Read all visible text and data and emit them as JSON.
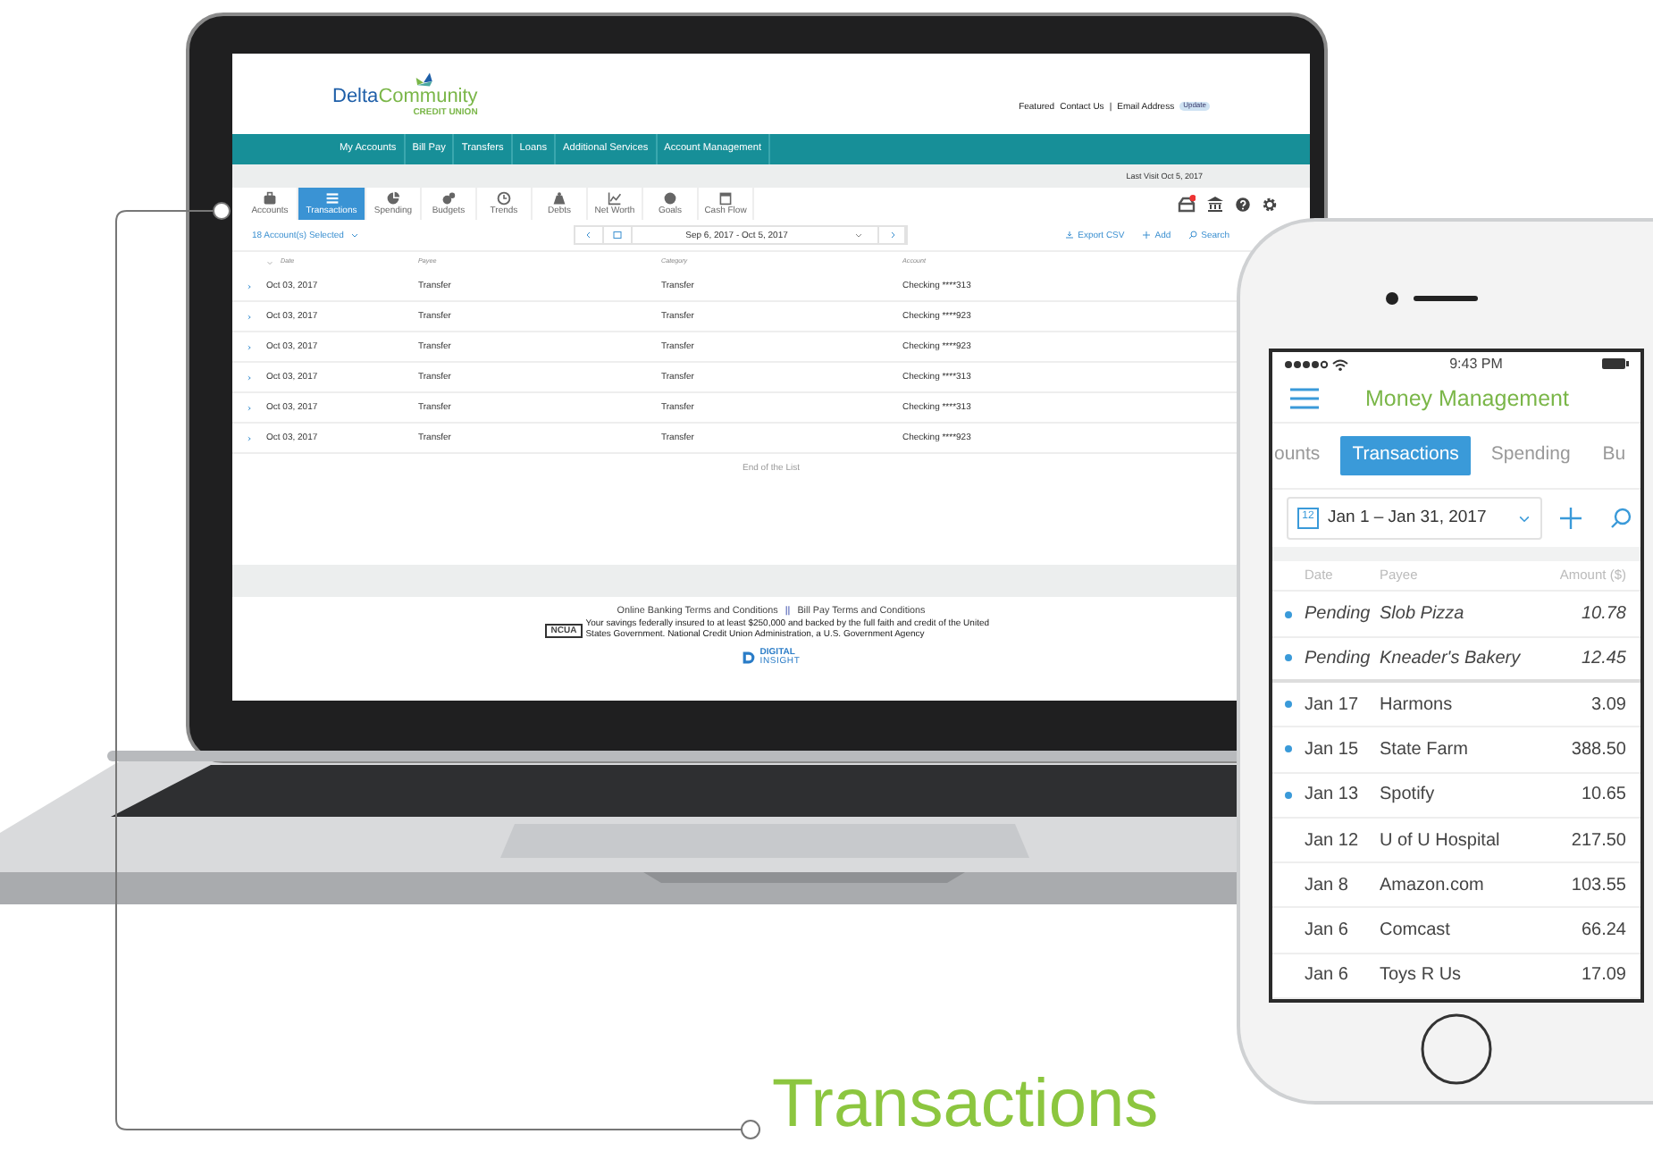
{
  "laptop": {
    "logo": {
      "words": [
        "Delta",
        "Community"
      ],
      "tagline": "CREDIT UNION"
    },
    "top_links": [
      "Featured",
      "Contact Us"
    ],
    "separator": "|",
    "email_label": "Email Address",
    "update_button": "Update",
    "nav": [
      "My Accounts",
      "Bill Pay",
      "Transfers",
      "Loans",
      "Additional Services",
      "Account Management"
    ],
    "last_visit": "Last Visit Oct 5, 2017",
    "tools": [
      {
        "label": "Accounts",
        "selected": false
      },
      {
        "label": "Transactions",
        "selected": true
      },
      {
        "label": "Spending",
        "selected": false
      },
      {
        "label": "Budgets",
        "selected": false
      },
      {
        "label": "Trends",
        "selected": false
      },
      {
        "label": "Debts",
        "selected": false
      },
      {
        "label": "Net Worth",
        "selected": false
      },
      {
        "label": "Goals",
        "selected": false
      },
      {
        "label": "Cash Flow",
        "selected": false
      }
    ],
    "accounts_filter": "18 Account(s) Selected",
    "date_range": "Sep 6, 2017 - Oct 5, 2017",
    "actions": [
      "Export CSV",
      "Add",
      "Search"
    ],
    "columns": [
      "Date",
      "Payee",
      "Category",
      "Account"
    ],
    "rows": [
      {
        "date": "Oct 03, 2017",
        "payee": "Transfer",
        "category": "Transfer",
        "account": "Checking ****313"
      },
      {
        "date": "Oct 03, 2017",
        "payee": "Transfer",
        "category": "Transfer",
        "account": "Checking ****923"
      },
      {
        "date": "Oct 03, 2017",
        "payee": "Transfer",
        "category": "Transfer",
        "account": "Checking ****923"
      },
      {
        "date": "Oct 03, 2017",
        "payee": "Transfer",
        "category": "Transfer",
        "account": "Checking ****313"
      },
      {
        "date": "Oct 03, 2017",
        "payee": "Transfer",
        "category": "Transfer",
        "account": "Checking ****313"
      },
      {
        "date": "Oct 03, 2017",
        "payee": "Transfer",
        "category": "Transfer",
        "account": "Checking ****923"
      }
    ],
    "end_note": "End of the List",
    "footer": {
      "links": [
        "Online Banking Terms and Conditions",
        "Bill Pay Terms and Conditions"
      ],
      "link_separator": "||",
      "insurer": "NCUA",
      "notice": "Your savings federally insured to at least $250,000 and backed by the full faith and credit of the United States Government. National Credit Union Administration, a U.S. Government Agency",
      "brand": [
        "DIGITAL",
        "INSIGHT"
      ]
    }
  },
  "phone": {
    "time": "9:43 PM",
    "title": "Money Management",
    "tabs": [
      {
        "label": "ounts",
        "selected": false
      },
      {
        "label": "Transactions",
        "selected": true
      },
      {
        "label": "Spending",
        "selected": false
      },
      {
        "label": "Bu",
        "selected": false
      }
    ],
    "calendar_day": "12",
    "date_range": "Jan 1 – Jan 31, 2017",
    "columns": [
      "Date",
      "Payee",
      "Amount ($)"
    ],
    "transactions": [
      {
        "date": "Pending",
        "payee": "Slob Pizza",
        "amount": "10.78",
        "pending": true,
        "new": true
      },
      {
        "date": "Pending",
        "payee": "Kneader's Bakery",
        "amount": "12.45",
        "pending": true,
        "new": true
      },
      {
        "date": "Jan 17",
        "payee": "Harmons",
        "amount": "3.09",
        "pending": false,
        "new": true
      },
      {
        "date": "Jan 15",
        "payee": "State Farm",
        "amount": "388.50",
        "pending": false,
        "new": true
      },
      {
        "date": "Jan 13",
        "payee": "Spotify",
        "amount": "10.65",
        "pending": false,
        "new": true
      },
      {
        "date": "Jan 12",
        "payee": "U of U Hospital",
        "amount": "217.50",
        "pending": false,
        "new": false
      },
      {
        "date": "Jan 8",
        "payee": "Amazon.com",
        "amount": "103.55",
        "pending": false,
        "new": false
      },
      {
        "date": "Jan 6",
        "payee": "Comcast",
        "amount": "66.24",
        "pending": false,
        "new": false
      },
      {
        "date": "Jan 6",
        "payee": "Toys R Us",
        "amount": "17.09",
        "pending": false,
        "new": false
      }
    ]
  },
  "caption": "Transactions"
}
